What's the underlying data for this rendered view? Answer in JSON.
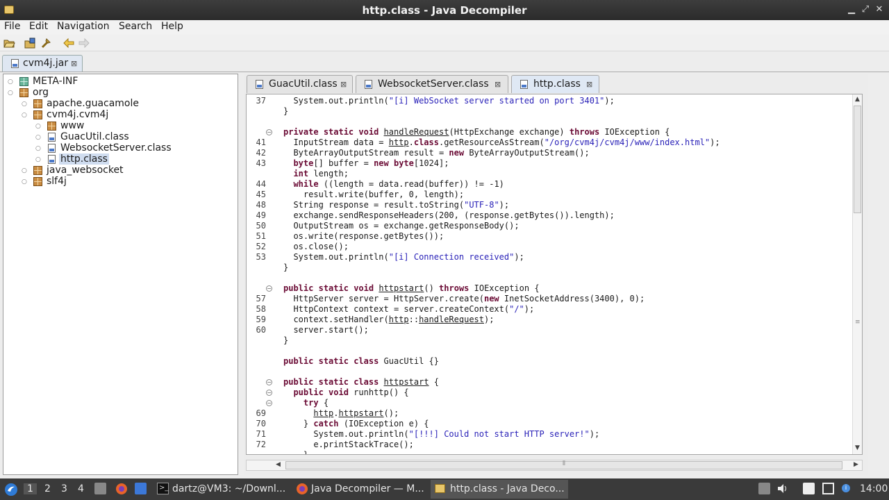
{
  "window": {
    "title": "http.class - Java Decompiler"
  },
  "menu": [
    "File",
    "Edit",
    "Navigation",
    "Search",
    "Help"
  ],
  "toolbar": {
    "icons": [
      "open-file-icon",
      "open-type-icon",
      "search-icon",
      "back-icon",
      "forward-icon"
    ]
  },
  "jar_tab": {
    "label": "cvm4j.jar"
  },
  "tree": {
    "nodes": [
      {
        "label": "META-INF",
        "icon": "folder-icon"
      },
      {
        "label": "org",
        "icon": "package-icon"
      },
      {
        "label": "apache.guacamole",
        "icon": "package-icon"
      },
      {
        "label": "cvm4j.cvm4j",
        "icon": "package-icon"
      },
      {
        "label": "www",
        "icon": "package-icon"
      },
      {
        "label": "GuacUtil.class",
        "icon": "class-file-icon"
      },
      {
        "label": "WebsocketServer.class",
        "icon": "class-file-icon"
      },
      {
        "label": "http.class",
        "icon": "class-file-icon",
        "selected": true
      },
      {
        "label": "java_websocket",
        "icon": "package-icon"
      },
      {
        "label": "slf4j",
        "icon": "package-icon"
      }
    ]
  },
  "editor": {
    "tabs": [
      {
        "label": "GuacUtil.class",
        "active": false
      },
      {
        "label": "WebsocketServer.class",
        "active": false
      },
      {
        "label": "http.class",
        "active": true
      }
    ],
    "lines": [
      {
        "n": "37",
        "code": "  System.out.println(\"[i] WebSocket server started on port 3401\");"
      },
      {
        "n": "",
        "code": "}"
      },
      {
        "n": "",
        "code": ""
      },
      {
        "n": "",
        "code": "private static void handleRequest(HttpExchange exchange) throws IOException {"
      },
      {
        "n": "41",
        "code": "  InputStream data = http.class.getResourceAsStream(\"/org/cvm4j/cvm4j/www/index.html\");"
      },
      {
        "n": "42",
        "code": "  ByteArrayOutputStream result = new ByteArrayOutputStream();"
      },
      {
        "n": "43",
        "code": "  byte[] buffer = new byte[1024];"
      },
      {
        "n": "",
        "code": "  int length;"
      },
      {
        "n": "44",
        "code": "  while ((length = data.read(buffer)) != -1)"
      },
      {
        "n": "45",
        "code": "    result.write(buffer, 0, length);"
      },
      {
        "n": "48",
        "code": "  String response = result.toString(\"UTF-8\");"
      },
      {
        "n": "49",
        "code": "  exchange.sendResponseHeaders(200, (response.getBytes()).length);"
      },
      {
        "n": "50",
        "code": "  OutputStream os = exchange.getResponseBody();"
      },
      {
        "n": "51",
        "code": "  os.write(response.getBytes());"
      },
      {
        "n": "52",
        "code": "  os.close();"
      },
      {
        "n": "53",
        "code": "  System.out.println(\"[i] Connection received\");"
      },
      {
        "n": "",
        "code": "}"
      },
      {
        "n": "",
        "code": ""
      },
      {
        "n": "",
        "code": "public static void httpstart() throws IOException {"
      },
      {
        "n": "57",
        "code": "  HttpServer server = HttpServer.create(new InetSocketAddress(3400), 0);"
      },
      {
        "n": "58",
        "code": "  HttpContext context = server.createContext(\"/\");"
      },
      {
        "n": "59",
        "code": "  context.setHandler(http::handleRequest);"
      },
      {
        "n": "60",
        "code": "  server.start();"
      },
      {
        "n": "",
        "code": "}"
      },
      {
        "n": "",
        "code": ""
      },
      {
        "n": "",
        "code": "public static class GuacUtil {}"
      },
      {
        "n": "",
        "code": ""
      },
      {
        "n": "",
        "code": "public static class httpstart {"
      },
      {
        "n": "",
        "code": "  public void runhttp() {"
      },
      {
        "n": "",
        "code": "    try {"
      },
      {
        "n": "69",
        "code": "      http.httpstart();"
      },
      {
        "n": "70",
        "code": "    } catch (IOException e) {"
      },
      {
        "n": "71",
        "code": "      System.out.println(\"[!!!] Could not start HTTP server!\");"
      },
      {
        "n": "72",
        "code": "      e.printStackTrace();"
      },
      {
        "n": "",
        "code": "    }"
      }
    ]
  },
  "taskbar": {
    "workspaces": [
      "1",
      "2",
      "3",
      "4"
    ],
    "tasks": [
      {
        "label": "dartz@VM3: ~/Downl..."
      },
      {
        "label": "Java Decompiler — M..."
      },
      {
        "label": "http.class - Java Deco..."
      }
    ],
    "clock": "14:00"
  }
}
